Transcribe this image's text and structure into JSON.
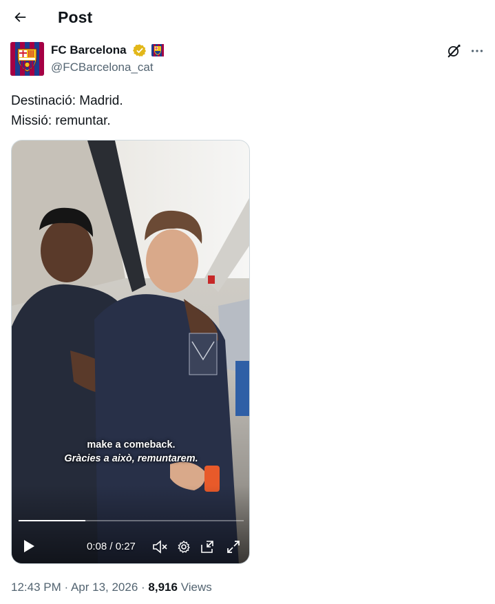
{
  "header": {
    "title": "Post"
  },
  "author": {
    "name": "FC Barcelona",
    "handle": "@FCBarcelona_cat",
    "verified_color": "#e2b719",
    "brand_blue": "#1c3c8f",
    "brand_red": "#a50044"
  },
  "tweet": {
    "lines": [
      "Destinació: Madrid.",
      "Missió: remuntar."
    ]
  },
  "video": {
    "caption_en": "make a comeback.",
    "caption_ca": "Gràcies a això, remuntarem.",
    "current_time": "0:08",
    "duration": "0:27",
    "time_display": "0:08 / 0:27",
    "progress_fraction": 0.296,
    "controls": [
      "play-icon",
      "mute-icon",
      "settings-icon",
      "pip-icon",
      "fullscreen-icon"
    ]
  },
  "meta": {
    "time": "12:43 PM",
    "date": "Apr 13, 2026",
    "separator": " · ",
    "views_count": "8,916",
    "views_label": "Views"
  }
}
